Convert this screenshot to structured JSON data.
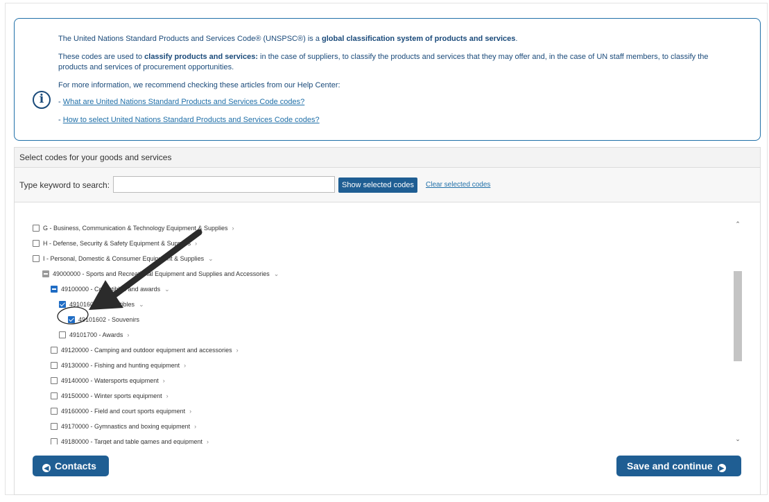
{
  "info": {
    "line1_pre": "The United Nations Standard Products and Services Code® (UNSPSC®) is a ",
    "line1_bold": "global classification system of products and services",
    "line1_post": ".",
    "line2_pre": "These codes are used to ",
    "line2_bold": "classify products and services:",
    "line2_post": " in the case of suppliers, to classify the products and services that they may offer and, in the case of UN staff members, to classify the",
    "line2b": "products and services of procurement opportunities.",
    "line3": "For more information, we recommend checking these articles from our Help Center:",
    "dash": "- ",
    "link1": "What are United Nations Standard Products and Services Code codes?",
    "link2": "How to select United Nations Standard Products and Services Code codes?"
  },
  "panel": {
    "title": "Select codes for your goods and services",
    "search_label": "Type keyword to search:",
    "search_value": "",
    "show_button": "Show selected codes",
    "clear_link": "Clear selected codes"
  },
  "tree": [
    {
      "label": "G - Business, Communication & Technology Equipment & Supplies",
      "state": "unchecked",
      "chevron": "›"
    },
    {
      "label": "H - Defense, Security & Safety Equipment & Supplies",
      "state": "unchecked",
      "chevron": "›"
    },
    {
      "label": "I - Personal, Domestic & Consumer Equipment & Supplies",
      "state": "unchecked",
      "chevron": "⌄"
    },
    {
      "label": "49000000 - Sports and Recreational Equipment and Supplies and Accessories",
      "state": "partial-gray",
      "chevron": "⌄"
    },
    {
      "label": "49100000 - Collectibles and awards",
      "state": "partial",
      "chevron": "⌄"
    },
    {
      "label": "49101600 - Collectibles",
      "state": "checked",
      "chevron": "⌄"
    },
    {
      "label": "49101602 - Souvenirs",
      "state": "checked",
      "chevron": ""
    },
    {
      "label": "49101700 - Awards",
      "state": "unchecked",
      "chevron": "›"
    },
    {
      "label": "49120000 - Camping and outdoor equipment and accessories",
      "state": "unchecked",
      "chevron": "›"
    },
    {
      "label": "49130000 - Fishing and hunting equipment",
      "state": "unchecked",
      "chevron": "›"
    },
    {
      "label": "49140000 - Watersports equipment",
      "state": "unchecked",
      "chevron": "›"
    },
    {
      "label": "49150000 - Winter sports equipment",
      "state": "unchecked",
      "chevron": "›"
    },
    {
      "label": "49160000 - Field and court sports equipment",
      "state": "unchecked",
      "chevron": "›"
    },
    {
      "label": "49170000 - Gymnastics and boxing equipment",
      "state": "unchecked",
      "chevron": "›"
    },
    {
      "label": "49180000 - Target and table games and equipment",
      "state": "unchecked",
      "chevron": "›"
    }
  ],
  "buttons": {
    "contacts": "Contacts",
    "save": "Save and continue"
  },
  "icons": {
    "info": "info-icon",
    "back": "arrow-left-circle-icon",
    "forward": "arrow-right-circle-icon",
    "annotation": "hand-drawn-arrow-icon"
  },
  "colors": {
    "primary": "#1f5e93",
    "link": "#1f6fa8",
    "checkbox": "#1f6cc4"
  }
}
